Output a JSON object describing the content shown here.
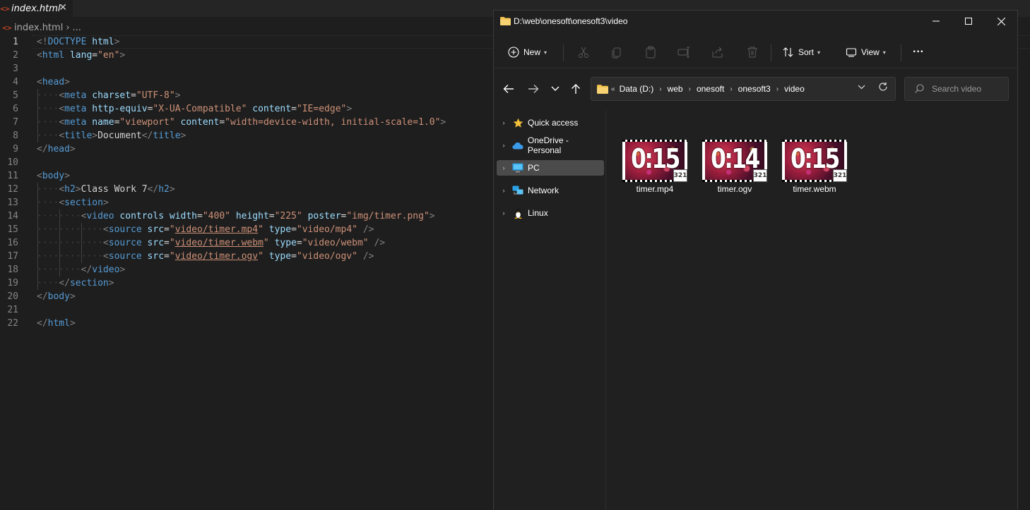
{
  "editor": {
    "tab_title": "index.html",
    "tab_close": "✕",
    "breadcrumb_file": "index.html",
    "breadcrumb_sep": "›",
    "breadcrumb_more": "...",
    "html_icon": "<>"
  },
  "code": {
    "line_numbers": [
      "1",
      "2",
      "3",
      "4",
      "5",
      "6",
      "7",
      "8",
      "9",
      "10",
      "11",
      "12",
      "13",
      "14",
      "15",
      "16",
      "17",
      "18",
      "19",
      "20",
      "21",
      "22"
    ],
    "active_line": 1
  },
  "explorer": {
    "title": "D:\\web\\onesoft\\onesoft3\\video",
    "toolbar": {
      "new_label": "New",
      "sort_label": "Sort",
      "view_label": "View",
      "more_label": "···"
    },
    "address": {
      "overflow": "«",
      "crumbs": [
        "Data (D:)",
        "web",
        "onesoft",
        "onesoft3",
        "video"
      ]
    },
    "search_placeholder": "Search video",
    "sidebar": [
      {
        "label": "Quick access",
        "icon": "star-icon"
      },
      {
        "label": "OneDrive - Personal",
        "icon": "cloud-icon"
      },
      {
        "label": "PC",
        "icon": "monitor-icon",
        "selected": true
      },
      {
        "label": "Network",
        "icon": "network-icon"
      },
      {
        "label": "Linux",
        "icon": "penguin-icon"
      }
    ],
    "files": [
      {
        "name": "timer.mp4",
        "thumb_text": "0:15"
      },
      {
        "name": "timer.ogv",
        "thumb_text": "0:14"
      },
      {
        "name": "timer.webm",
        "thumb_text": "0:15"
      }
    ],
    "badge_text": "321"
  }
}
